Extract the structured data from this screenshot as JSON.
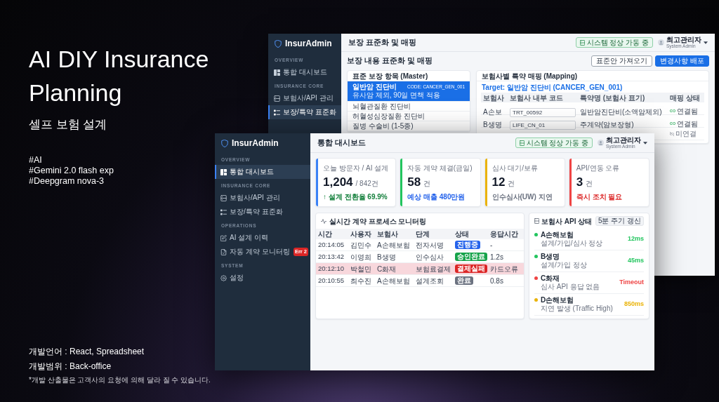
{
  "slide": {
    "title": "AI DIY Insurance Planning",
    "subtitle": "셀프 보험 설계",
    "tags": [
      "#AI",
      "#Gemini 2.0 flash exp",
      "#Deepgram nova-3"
    ],
    "details": [
      "개발언어 : React, Spreadsheet",
      "개발범위 : Back-office"
    ],
    "footnote": "*개발 산출물은 고객사의 요청에 의해 달라 질 수 있습니다."
  },
  "back_window": {
    "logo": "InsurAdmin",
    "sidebar": [
      {
        "heading": "OVERVIEW",
        "items": [
          {
            "label": "통합 대시보드",
            "selected": false
          }
        ]
      },
      {
        "heading": "INSURANCE CORE",
        "items": [
          {
            "label": "보험사/API 관리",
            "selected": false
          },
          {
            "label": "보장/특약 표준화",
            "selected": true
          }
        ]
      }
    ],
    "header": {
      "title": "보장 표준화 및 매핑",
      "status_badge": "시스템 정상 가동 중",
      "user_name": "최고관리자",
      "user_role": "System Admin"
    },
    "section_title": "보장 내용 표준화 및 매핑",
    "buttons": [
      {
        "label": "표준안 가져오기",
        "kind": "outline"
      },
      {
        "label": "변경사항 배포",
        "kind": "primary"
      }
    ],
    "master": {
      "title": "표준 보장 항목 (Master)",
      "items": [
        {
          "name": "일반암 진단비",
          "code": "CODE: CANCER_GEN_001",
          "note": "유사암 제외, 90일 면책 적용",
          "selected": true
        },
        {
          "name": "뇌혈관질환 진단비",
          "selected": false
        },
        {
          "name": "허혈성심장질환 진단비",
          "selected": false
        },
        {
          "name": "질병 수술비 (1-5종)",
          "selected": false
        }
      ]
    },
    "mapping": {
      "title": "보험사별 특약 매핑 (Mapping)",
      "target": "Target: 일반암 진단비 (CANCER_GEN_001)",
      "columns": [
        "보험사",
        "보험사 내부 코드",
        "특약명 (보험사 표기)",
        "매핑 상태"
      ],
      "rows": [
        {
          "insurer": "A손보",
          "code": "TRT_00592",
          "rider": "일반암진단비(소액암제외)",
          "status": {
            "label": "연결됨",
            "linked": true
          }
        },
        {
          "insurer": "B생명",
          "code": "LIFE_CN_01",
          "rider": "주계약(암보장형)",
          "status": {
            "label": "연결됨",
            "linked": true
          }
        },
        {
          "status": {
            "label": "미연결",
            "linked": false
          }
        }
      ]
    }
  },
  "front_window": {
    "logo": "InsurAdmin",
    "sidebar": [
      {
        "heading": "OVERVIEW",
        "items": [
          {
            "label": "통합 대시보드",
            "selected": true
          }
        ]
      },
      {
        "heading": "INSURANCE CORE",
        "items": [
          {
            "label": "보험사/API 관리",
            "selected": false
          },
          {
            "label": "보장/특약 표준화",
            "selected": false
          }
        ]
      },
      {
        "heading": "OPERATIONS",
        "items": [
          {
            "label": "AI 설계 이력",
            "selected": false
          },
          {
            "label": "자동 계약 모니터링",
            "selected": false,
            "badge": "Err 2"
          }
        ]
      },
      {
        "heading": "SYSTEM",
        "items": [
          {
            "label": "설정",
            "selected": false
          }
        ]
      }
    ],
    "header": {
      "title": "통합 대시보드",
      "status_badge": "시스템 정상 가동 중",
      "user_name": "최고관리자",
      "user_role": "System Admin"
    },
    "stats": [
      {
        "label": "오늘 방문자 / AI 설계",
        "value": "1,204",
        "unit": "/ 842건",
        "note": {
          "text": "↑ 설계 전환율 69.9%",
          "color": "#15803d"
        },
        "color": "#3b82f6"
      },
      {
        "label": "자동 계약 체결(금일)",
        "value": "58",
        "unit": "건",
        "note": {
          "text": "예상 매출 480만원",
          "color": "#2563eb"
        },
        "color": "#22c55e"
      },
      {
        "label": "심사 대기/보류",
        "value": "12",
        "unit": "건",
        "note": {
          "text": "인수심사(UW) 지연",
          "color": "#6b7280"
        },
        "color": "#eab308"
      },
      {
        "label": "API/연동 오류",
        "value": "3",
        "unit": "건",
        "note": {
          "text": "즉시 조치 필요",
          "color": "#dc2626"
        },
        "color": "#ef4444"
      }
    ],
    "monitor": {
      "title": "실시간 계약 프로세스 모니터링",
      "columns": [
        "시간",
        "사용자",
        "보험사",
        "단계",
        "상태",
        "응답시간"
      ],
      "rows": [
        {
          "time": "20:14:05",
          "user": "김민수",
          "insurer": "A손해보험",
          "stage": "전자서명",
          "status": {
            "label": "진행중",
            "color": "#2563eb"
          },
          "response": "-",
          "highlighted": false
        },
        {
          "time": "20:13:42",
          "user": "이영희",
          "insurer": "B생명",
          "stage": "인수심사",
          "status": {
            "label": "승인완료",
            "color": "#16a34a"
          },
          "response": "1.2s",
          "highlighted": false
        },
        {
          "time": "20:12:10",
          "user": "박철민",
          "insurer": "C화재",
          "stage": "보험료결제",
          "status": {
            "label": "결제실패",
            "color": "#dc2626"
          },
          "response": "카드오류",
          "highlighted": true
        },
        {
          "time": "20:10:55",
          "user": "최수진",
          "insurer": "A손해보험",
          "stage": "설계조회",
          "status": {
            "label": "완료",
            "color": "#6b7280"
          },
          "response": "0.8s",
          "highlighted": false
        }
      ]
    },
    "api_status": {
      "title": "보험사 API 상태",
      "refresh": "5분 주기 갱신",
      "items": [
        {
          "name": "A손해보험",
          "detail": "설계/가입/심사 정상",
          "latency": "12ms",
          "color": "#22c55e"
        },
        {
          "name": "B생명",
          "detail": "설계/가입 정상",
          "latency": "45ms",
          "color": "#22c55e"
        },
        {
          "name": "C화재",
          "detail": "심사 API 응답 없음",
          "latency": "Timeout",
          "color": "#ef4444"
        },
        {
          "name": "D손해보험",
          "detail": "지연 발생 (Traffic High)",
          "latency": "850ms",
          "color": "#eab308"
        }
      ]
    }
  }
}
